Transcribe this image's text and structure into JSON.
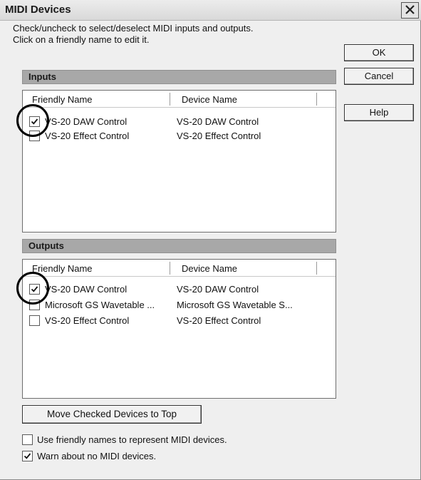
{
  "window": {
    "title": "MIDI Devices",
    "close_glyph": "✕"
  },
  "instructions": {
    "line1": "Check/uncheck to select/deselect MIDI inputs and outputs.",
    "line2": "Click on a friendly name to edit it."
  },
  "buttons": {
    "ok": "OK",
    "cancel": "Cancel",
    "help": "Help",
    "move_checked": "Move Checked Devices to Top"
  },
  "inputs": {
    "header": "Inputs",
    "columns": {
      "friendly": "Friendly Name",
      "device": "Device Name"
    },
    "rows": [
      {
        "checked": true,
        "friendly": "VS-20 DAW Control",
        "device": "VS-20 DAW Control"
      },
      {
        "checked": false,
        "friendly": "VS-20 Effect Control",
        "device": "VS-20 Effect Control"
      }
    ]
  },
  "outputs": {
    "header": "Outputs",
    "columns": {
      "friendly": "Friendly Name",
      "device": "Device Name"
    },
    "rows": [
      {
        "checked": true,
        "friendly": "VS-20 DAW Control",
        "device": "VS-20 DAW Control"
      },
      {
        "checked": false,
        "friendly": "Microsoft GS Wavetable ...",
        "device": "Microsoft GS Wavetable S..."
      },
      {
        "checked": false,
        "friendly": "VS-20 Effect Control",
        "device": "VS-20 Effect Control"
      }
    ]
  },
  "options": {
    "friendly_names": {
      "checked": false,
      "label": "Use friendly names to represent MIDI devices."
    },
    "warn_no_devices": {
      "checked": true,
      "label": "Warn about no MIDI devices."
    }
  },
  "icons": [
    "close-icon",
    "checkmark-icon"
  ],
  "colors": {
    "section_header": "#a8a8a8",
    "window_bg": "#efefef"
  }
}
